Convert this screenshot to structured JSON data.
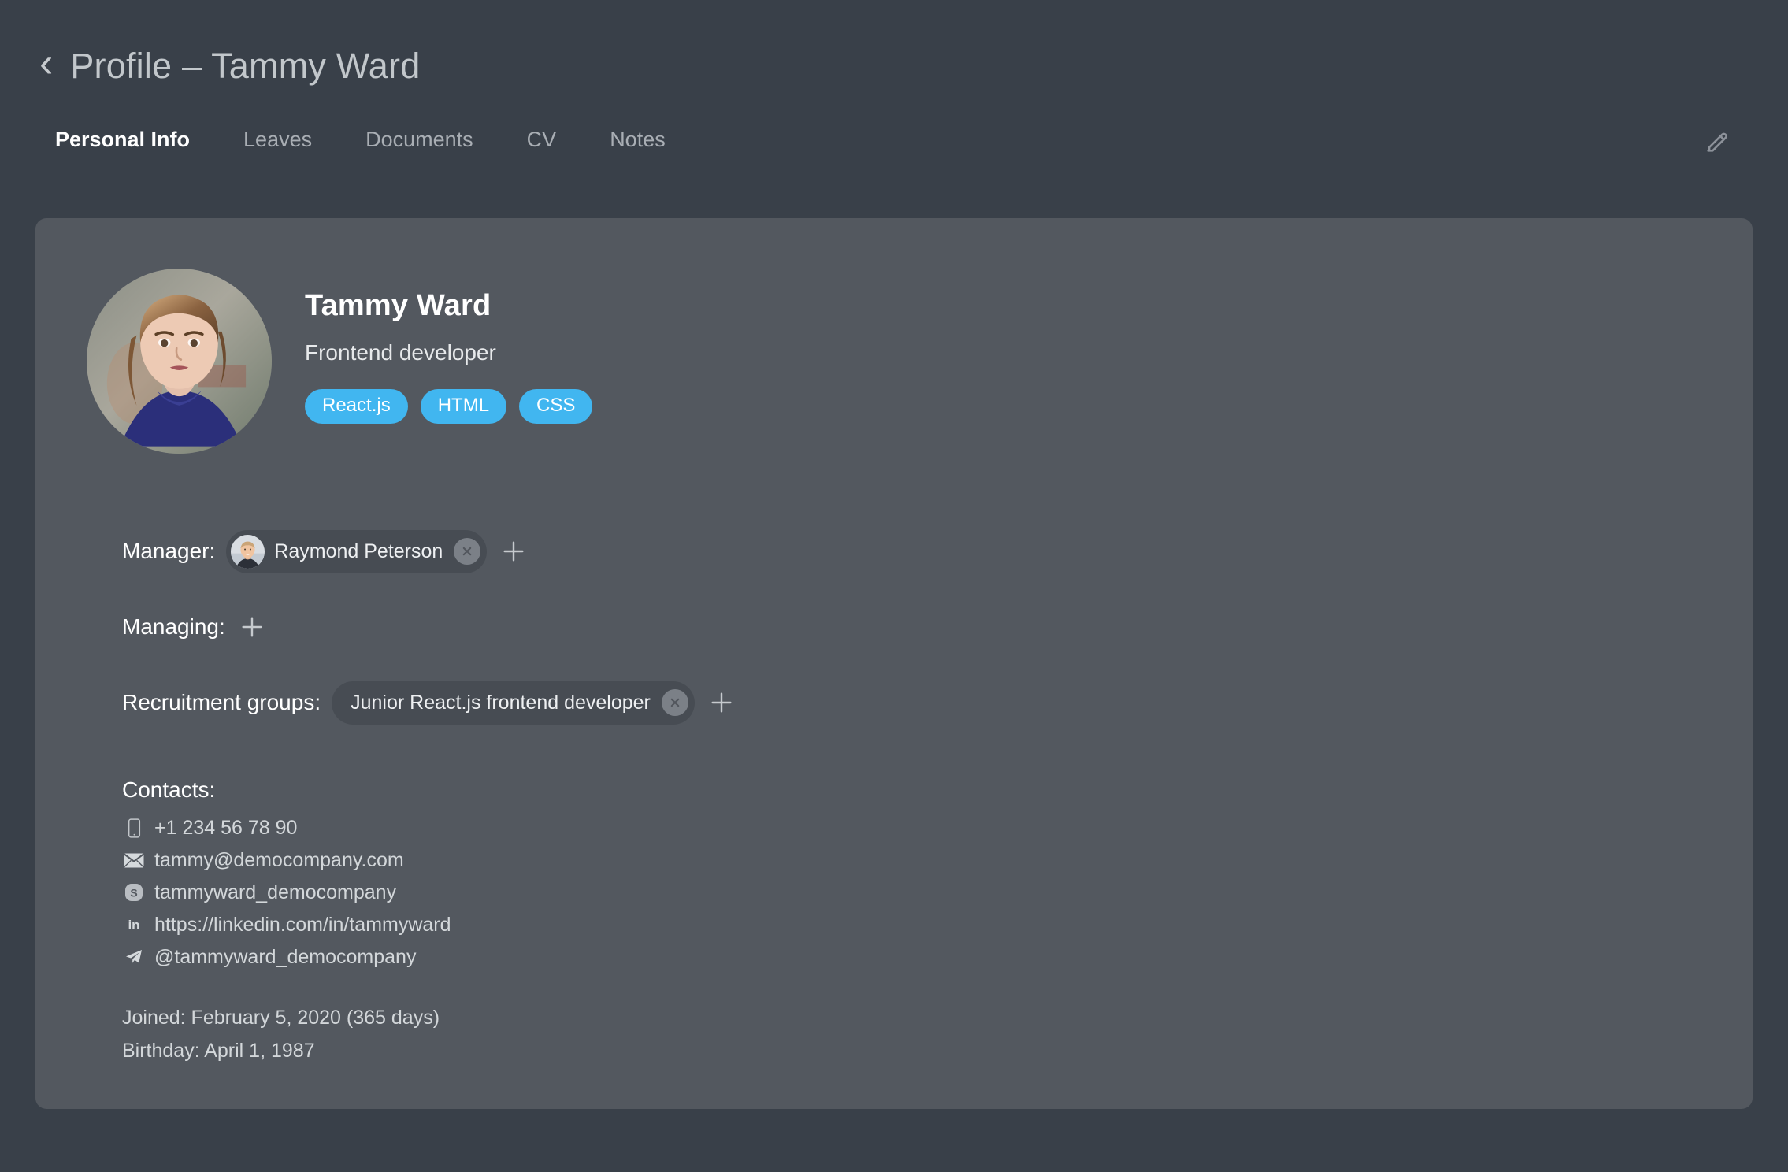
{
  "header": {
    "back_icon": "chevron-left-icon",
    "title": "Profile – Tammy Ward"
  },
  "tabs": [
    {
      "label": "Personal Info",
      "active": true
    },
    {
      "label": "Leaves",
      "active": false
    },
    {
      "label": "Documents",
      "active": false
    },
    {
      "label": "CV",
      "active": false
    },
    {
      "label": "Notes",
      "active": false
    }
  ],
  "toolbar": {
    "edit_icon": "pencil-edit-icon"
  },
  "profile": {
    "avatar_alt": "Tammy Ward portrait photo",
    "name": "Tammy Ward",
    "role": "Frontend developer",
    "tags": [
      "React.js",
      "HTML",
      "CSS"
    ]
  },
  "fields": {
    "manager": {
      "label": "Manager:",
      "chip": {
        "name": "Raymond Peterson",
        "avatar_alt": "Raymond Peterson portrait photo",
        "remove_icon": "close-circle-icon"
      },
      "add_icon": "plus-icon"
    },
    "managing": {
      "label": "Managing:",
      "chips": [],
      "add_icon": "plus-icon"
    },
    "recruitment_groups": {
      "label": "Recruitment groups:",
      "chip": {
        "name": "Junior React.js frontend developer",
        "remove_icon": "close-circle-icon"
      },
      "add_icon": "plus-icon"
    }
  },
  "contacts": {
    "title": "Contacts:",
    "items": [
      {
        "icon": "phone-icon",
        "value": "+1 234 56 78 90"
      },
      {
        "icon": "envelope-icon",
        "value": "tammy@democompany.com"
      },
      {
        "icon": "skype-icon",
        "value": "tammyward_democompany"
      },
      {
        "icon": "linkedin-icon",
        "value": "https://linkedin.com/in/tammyward"
      },
      {
        "icon": "telegram-icon",
        "value": "@tammyward_democompany"
      }
    ]
  },
  "dates": {
    "joined": "Joined: February 5, 2020 (365 days)",
    "birthday": "Birthday: April 1, 1987"
  },
  "colors": {
    "page_background": "#394049",
    "card_background": "#53585f",
    "tag_blue": "#41b6f0",
    "chip_background": "#474c53",
    "active_tab": "#ffffff",
    "muted_text": "#a9aeb4"
  }
}
